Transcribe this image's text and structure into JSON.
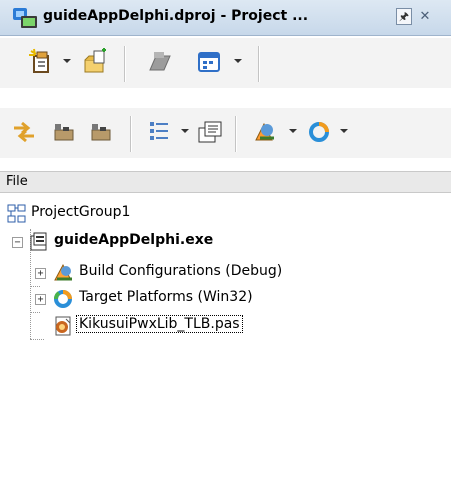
{
  "window": {
    "title": "guideAppDelphi.dproj - Project ...",
    "pin_glyph": "🖈",
    "close_glyph": "✕"
  },
  "toolbar1": {
    "items": [
      "new-item-icon",
      "dropdown-arrow-icon",
      "add-file-icon",
      "remove-icon",
      "options-icon",
      "dropdown-arrow-icon"
    ]
  },
  "toolbar2": {
    "items": [
      "sync-icon",
      "activate-icon",
      "deactivate-icon",
      "sort-icon",
      "dropdown-arrow-icon",
      "compile-icon",
      "build-config-icon",
      "dropdown-arrow-icon",
      "target-platform-icon",
      "dropdown-arrow-icon"
    ]
  },
  "header": {
    "label": "File"
  },
  "tree": {
    "group": "ProjectGroup1",
    "project": "guideAppDelphi.exe",
    "children": [
      {
        "label": "Build Configurations (Debug)",
        "expander": "+"
      },
      {
        "label": "Target Platforms (Win32)",
        "expander": "+"
      },
      {
        "label": "KikusuiPwxLib_TLB.pas"
      }
    ],
    "project_expander": "−"
  },
  "colors": {
    "title_bg": "#c7d8ea",
    "toolbar_bg": "#f3f3f3",
    "header_bg": "#e9e9e9",
    "selection_border": "#000000"
  }
}
